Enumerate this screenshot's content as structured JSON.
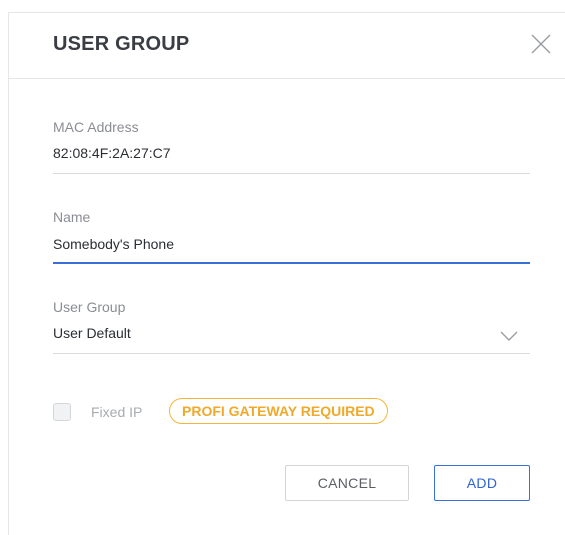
{
  "dialog": {
    "title": "USER GROUP"
  },
  "fields": {
    "mac": {
      "label": "MAC Address",
      "value": "82:08:4F:2A:27:C7"
    },
    "name": {
      "label": "Name",
      "value": "Somebody's Phone"
    },
    "user_group": {
      "label": "User Group",
      "selected": "User Default"
    }
  },
  "fixed_ip": {
    "label": "Fixed IP",
    "checked": false,
    "badge": "PROFI GATEWAY REQUIRED"
  },
  "buttons": {
    "cancel": "CANCEL",
    "add": "ADD"
  },
  "icons": {
    "close": "close-icon",
    "dropdown": "chevron-down-icon"
  },
  "colors": {
    "accent": "#3a6fd8",
    "badge": "#f4b63a",
    "label": "#8a8d93"
  }
}
